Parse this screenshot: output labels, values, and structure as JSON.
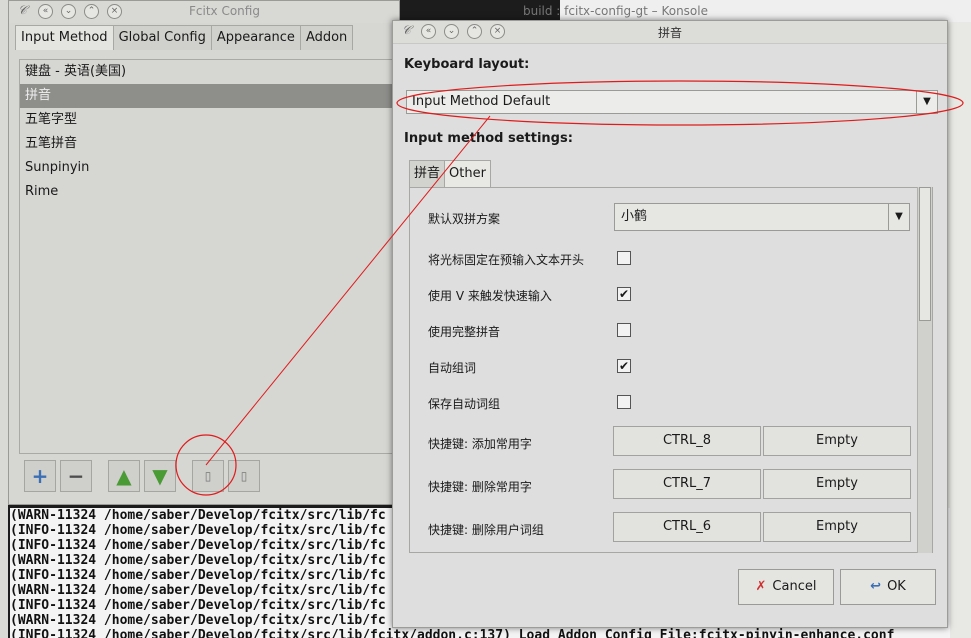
{
  "konsole": {
    "title": "build : fcitx-config-gt – Konsole",
    "lines": [
      "(WARN-11324 /home/saber/Develop/fcitx/src/lib/fc",
      "(INFO-11324 /home/saber/Develop/fcitx/src/lib/fc",
      "(INFO-11324 /home/saber/Develop/fcitx/src/lib/fc",
      "(WARN-11324 /home/saber/Develop/fcitx/src/lib/fc",
      "(INFO-11324 /home/saber/Develop/fcitx/src/lib/fc",
      "(WARN-11324 /home/saber/Develop/fcitx/src/lib/fc",
      "(INFO-11324 /home/saber/Develop/fcitx/src/lib/fc",
      "(WARN-11324 /home/saber/Develop/fcitx/src/lib/fc",
      "(INFO-11324 /home/saber/Develop/fcitx/src/lib/fcitx/addon.c:137) Load Addon Config File:fcitx-pinyin-enhance.conf"
    ]
  },
  "fcitx": {
    "title": "Fcitx Config",
    "tabs": [
      "Input Method",
      "Global Config",
      "Appearance",
      "Addon"
    ],
    "items": [
      "键盘 - 英语(美国)",
      "拼音",
      "五笔字型",
      "五笔拼音",
      "Sunpinyin",
      "Rime"
    ]
  },
  "dialog": {
    "title": "拼音",
    "keyboard_layout_label": "Keyboard layout:",
    "keyboard_layout_value": "Input Method Default",
    "im_settings_label": "Input method settings:",
    "tabs": [
      "拼音",
      "Other"
    ],
    "shuangpin_label": "默认双拼方案",
    "shuangpin_value": "小鹤",
    "options": [
      {
        "label": "将光标固定在预输入文本开头",
        "checked": false
      },
      {
        "label": "使用 V 来触发快速输入",
        "checked": true
      },
      {
        "label": "使用完整拼音",
        "checked": false
      },
      {
        "label": "自动组词",
        "checked": true
      },
      {
        "label": "保存自动词组",
        "checked": false
      }
    ],
    "shortcuts": [
      {
        "label": "快捷键: 添加常用字",
        "key": "CTRL_8",
        "alt": "Empty"
      },
      {
        "label": "快捷键: 删除常用字",
        "key": "CTRL_7",
        "alt": "Empty"
      },
      {
        "label": "快捷键: 删除用户词组",
        "key": "CTRL_6",
        "alt": "Empty"
      }
    ],
    "cancel_label": "Cancel",
    "ok_label": "OK"
  },
  "colors": {
    "annotation": "#e01b1b"
  }
}
